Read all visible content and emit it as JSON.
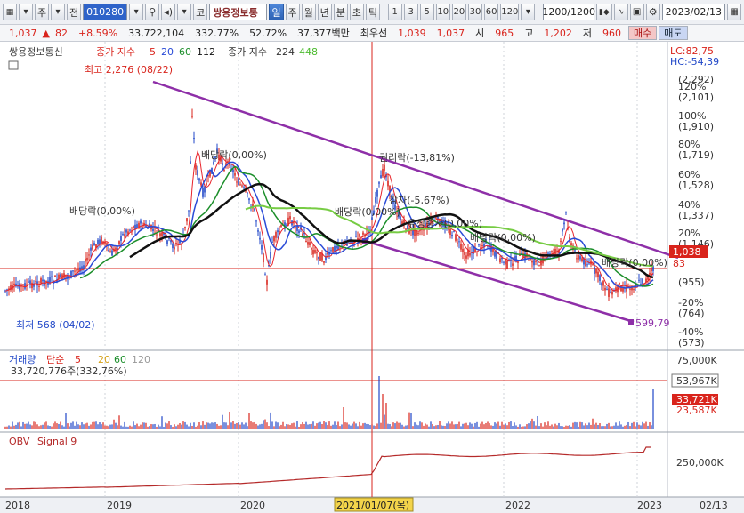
{
  "toolbar": {
    "left_buttons": [
      "주",
      "전"
    ],
    "stock_code": "010280",
    "stock_name": "쌍용정보통",
    "period_buttons": [
      "일",
      "주",
      "월",
      "년",
      "분",
      "초",
      "틱"
    ],
    "active_period": "일",
    "minute_options": [
      "1",
      "3",
      "5",
      "10",
      "20",
      "30",
      "60",
      "120"
    ],
    "bar_count": "1200/1200",
    "date": "2023/02/13",
    "prefix_button": "코"
  },
  "infobar": {
    "price": "1,037",
    "change": "82",
    "change_pct": "+8.59%",
    "volume": "33,722,104",
    "volume_pct": "332.77%",
    "turnover": "52.72%",
    "amount": "37,377백만",
    "priority_label": "최우선",
    "ask": "1,039",
    "bid": "1,037",
    "open_label": "시",
    "open": "965",
    "high_label": "고",
    "high": "1,202",
    "low_label": "저",
    "low": "960",
    "buy_label": "매수",
    "sell_label": "매도",
    "colors": {
      "up": "#d9241c",
      "down": "#2047c8"
    }
  },
  "price_panel": {
    "legend_name": "쌍용정보통신",
    "legend_ma_title": "종가 지수",
    "legend_ma_periods": [
      "5",
      "20",
      "60",
      "112"
    ],
    "legend_ma2_title": "종가 지수",
    "legend_ma2_period": "224",
    "legend_ma2_extra": "448",
    "ma_colors": [
      "#e8242b",
      "#2a4bd7",
      "#1b8e2a",
      "#111111",
      "#77cc44"
    ],
    "annotations": {
      "high": "최고 2,276 (08/22)",
      "low": "최저 568 (04/02)",
      "div1": "배당락(0,00%)",
      "div2": "배당락(0,00%)",
      "rights": "권리락(-13,81%)",
      "reduction": "감자(-5,67%)",
      "div3": "배당락(0,00%)",
      "issue": "유상증자(0,00%)",
      "div4": "배당락(0,00%)",
      "div5": "배당락(0,00%)",
      "channel_end": "599,79"
    },
    "axis_right": {
      "lc": "LC:82,75",
      "hc": "HC:-54,39",
      "ticks": [
        {
          "pct": "",
          "price": "(2,292)"
        },
        {
          "pct": "120%",
          "price": "(2,101)"
        },
        {
          "pct": "100%",
          "price": "(1,910)"
        },
        {
          "pct": "80%",
          "price": "(1,719)"
        },
        {
          "pct": "60%",
          "price": "(1,528)"
        },
        {
          "pct": "40%",
          "price": "(1,337)"
        },
        {
          "pct": "20%",
          "price": "(1,146)"
        },
        {
          "pct": "",
          "price": "(955)"
        },
        {
          "pct": "-20%",
          "price": "(764)"
        },
        {
          "pct": "-40%",
          "price": "(573)"
        }
      ],
      "current_price": "1,038",
      "current_change": "83"
    }
  },
  "volume_panel": {
    "legend_title": "거래량",
    "legend_type": "단순",
    "legend_periods": [
      "5",
      "20",
      "60",
      "120"
    ],
    "sub_label": "33,720,776주(332,76%)",
    "axis_labels": [
      "75,000K",
      "53,967K",
      "33,721K",
      "23,587K"
    ]
  },
  "obv_panel": {
    "legend_title": "OBV",
    "legend_signal": "Signal 9",
    "axis_label": "250,000K"
  },
  "x_axis": {
    "labels": [
      "2018",
      "2019",
      "2020",
      "2021/01/07(목)",
      "2022",
      "2023"
    ],
    "corner": "02/13"
  }
}
